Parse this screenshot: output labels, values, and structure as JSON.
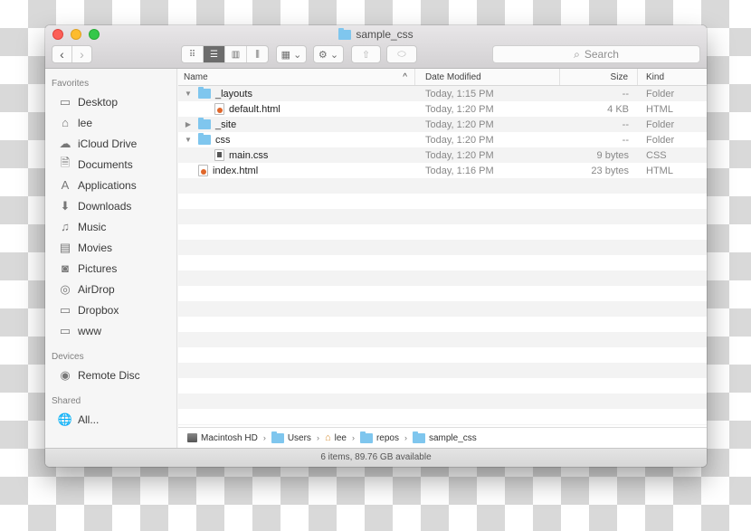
{
  "window": {
    "title": "sample_css"
  },
  "toolbar": {
    "back_icon": "‹",
    "forward_icon": "›",
    "views": [
      {
        "name": "icon-view",
        "glyph": "⠿",
        "active": false
      },
      {
        "name": "list-view",
        "glyph": "☰",
        "active": true
      },
      {
        "name": "column-view",
        "glyph": "▥",
        "active": false
      },
      {
        "name": "cover-flow-view",
        "glyph": "⫼",
        "active": false
      }
    ],
    "arrange_glyph": "▦ ⌄",
    "action_glyph": "⚙ ⌄",
    "share_glyph": "⇧",
    "tag_glyph": "⬭",
    "search_icon": "⌕",
    "search_placeholder": "Search"
  },
  "sidebar": {
    "favorites_heading": "Favorites",
    "favorites": [
      {
        "label": "Desktop",
        "icon": "desktop-icon",
        "glyph": "▭"
      },
      {
        "label": "lee",
        "icon": "home-icon",
        "glyph": "⌂"
      },
      {
        "label": "iCloud Drive",
        "icon": "cloud-icon",
        "glyph": "☁"
      },
      {
        "label": "Documents",
        "icon": "documents-icon",
        "glyph": "🗎"
      },
      {
        "label": "Applications",
        "icon": "applications-icon",
        "glyph": "A"
      },
      {
        "label": "Downloads",
        "icon": "downloads-icon",
        "glyph": "⬇"
      },
      {
        "label": "Music",
        "icon": "music-icon",
        "glyph": "♫"
      },
      {
        "label": "Movies",
        "icon": "movies-icon",
        "glyph": "▤"
      },
      {
        "label": "Pictures",
        "icon": "camera-icon",
        "glyph": "◙"
      },
      {
        "label": "AirDrop",
        "icon": "airdrop-icon",
        "glyph": "◎"
      },
      {
        "label": "Dropbox",
        "icon": "folder-icon",
        "glyph": "▭"
      },
      {
        "label": "www",
        "icon": "folder-icon",
        "glyph": "▭"
      }
    ],
    "devices_heading": "Devices",
    "devices": [
      {
        "label": "Remote Disc",
        "icon": "disc-icon",
        "glyph": "◉"
      }
    ],
    "shared_heading": "Shared",
    "shared": [
      {
        "label": "All...",
        "icon": "network-globe-icon",
        "glyph": "🌐"
      }
    ]
  },
  "columns": {
    "name": "Name",
    "sort_indicator": "^",
    "date": "Date Modified",
    "size": "Size",
    "kind": "Kind"
  },
  "files": [
    {
      "name": "_layouts",
      "type": "folder",
      "indent": 0,
      "disclosure": "▼",
      "date": "Today, 1:15 PM",
      "size": "--",
      "kind": "Folder"
    },
    {
      "name": "default.html",
      "type": "html",
      "indent": 1,
      "disclosure": "",
      "date": "Today, 1:20 PM",
      "size": "4 KB",
      "kind": "HTML"
    },
    {
      "name": "_site",
      "type": "folder",
      "indent": 0,
      "disclosure": "▶",
      "date": "Today, 1:20 PM",
      "size": "--",
      "kind": "Folder"
    },
    {
      "name": "css",
      "type": "folder",
      "indent": 0,
      "disclosure": "▼",
      "date": "Today, 1:20 PM",
      "size": "--",
      "kind": "Folder"
    },
    {
      "name": "main.css",
      "type": "css",
      "indent": 1,
      "disclosure": "",
      "date": "Today, 1:20 PM",
      "size": "9 bytes",
      "kind": "CSS"
    },
    {
      "name": "index.html",
      "type": "html",
      "indent": 0,
      "disclosure": "",
      "date": "Today, 1:16 PM",
      "size": "23 bytes",
      "kind": "HTML"
    }
  ],
  "path_bar": {
    "separator": "›",
    "segments": [
      {
        "label": "Macintosh HD",
        "icon": "disk-icon"
      },
      {
        "label": "Users",
        "icon": "folder-icon"
      },
      {
        "label": "lee",
        "icon": "home-icon"
      },
      {
        "label": "repos",
        "icon": "folder-icon"
      },
      {
        "label": "sample_css",
        "icon": "folder-icon"
      }
    ]
  },
  "status": {
    "text": "6 items, 89.76 GB available"
  },
  "colors": {
    "close": "#fc5f57",
    "minimize": "#fdbc2e",
    "maximize": "#34c84a",
    "folder": "#7fc6ee"
  }
}
